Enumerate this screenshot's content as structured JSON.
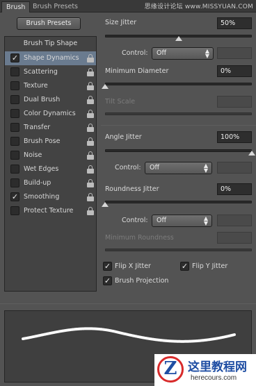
{
  "tabs": [
    {
      "label": "Brush",
      "active": true
    },
    {
      "label": "Brush Presets",
      "active": false
    }
  ],
  "watermark": "思缘设计论坛 www.MISSYUAN.COM",
  "brush_presets_button": "Brush Presets",
  "brush_tip_shape": "Brush Tip Shape",
  "sidebar": {
    "items": [
      {
        "label": "Shape Dynamics",
        "checked": true,
        "selected": true
      },
      {
        "label": "Scattering",
        "checked": false,
        "selected": false
      },
      {
        "label": "Texture",
        "checked": false,
        "selected": false
      },
      {
        "label": "Dual Brush",
        "checked": false,
        "selected": false
      },
      {
        "label": "Color Dynamics",
        "checked": false,
        "selected": false
      },
      {
        "label": "Transfer",
        "checked": false,
        "selected": false
      },
      {
        "label": "Brush Pose",
        "checked": false,
        "selected": false
      },
      {
        "label": "Noise",
        "checked": false,
        "selected": false
      },
      {
        "label": "Wet Edges",
        "checked": false,
        "selected": false
      },
      {
        "label": "Build-up",
        "checked": false,
        "selected": false
      },
      {
        "label": "Smoothing",
        "checked": true,
        "selected": false
      },
      {
        "label": "Protect Texture",
        "checked": false,
        "selected": false
      }
    ]
  },
  "size_jitter": {
    "label": "Size Jitter",
    "value": "50%",
    "level": 0.5
  },
  "size_control": {
    "label": "Control:",
    "value": "Off",
    "enabled": false
  },
  "min_diameter": {
    "label": "Minimum Diameter",
    "value": "0%",
    "level": 0
  },
  "tilt_scale": {
    "label": "Tilt Scale",
    "enabled": false
  },
  "angle_jitter": {
    "label": "Angle Jitter",
    "value": "100%",
    "level": 1
  },
  "angle_control": {
    "label": "Control:",
    "value": "Off"
  },
  "roundness_jitter": {
    "label": "Roundness Jitter",
    "value": "0%",
    "level": 0
  },
  "roundness_control": {
    "label": "Control:",
    "value": "Off"
  },
  "min_roundness": {
    "label": "Minimum Roundness",
    "enabled": false
  },
  "flip_x": {
    "label": "Flip X Jitter",
    "checked": true
  },
  "flip_y": {
    "label": "Flip Y Jitter",
    "checked": true
  },
  "brush_projection": {
    "label": "Brush Projection",
    "checked": true
  },
  "logo": {
    "title": "这里教程网",
    "url": "herecours.com",
    "mark": "Z"
  },
  "colors": {
    "panel": "#535353",
    "selection": "#6a7b8f",
    "field": "#2e2e2e"
  }
}
